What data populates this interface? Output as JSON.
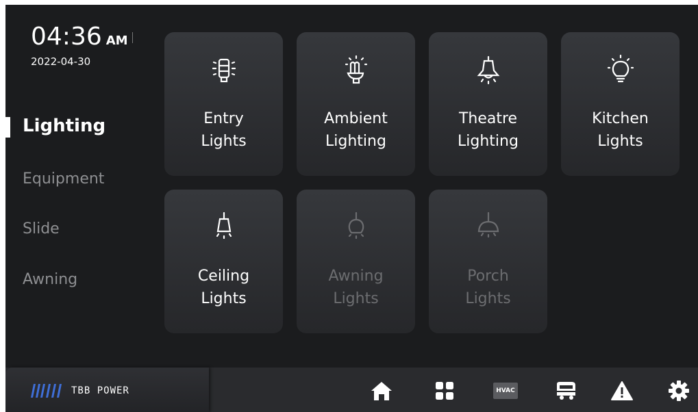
{
  "clock": {
    "time": "04:36",
    "ampm": "AM",
    "date": "2022-04-30"
  },
  "sidebar": {
    "items": [
      {
        "label": "Lighting",
        "active": true
      },
      {
        "label": "Equipment",
        "active": false
      },
      {
        "label": "Slide",
        "active": false
      },
      {
        "label": "Awning",
        "active": false
      }
    ]
  },
  "tiles": [
    {
      "line1": "Entry",
      "line2": "Lights",
      "icon": "entry-light-icon",
      "enabled": true
    },
    {
      "line1": "Ambient",
      "line2": "Lighting",
      "icon": "ambient-bulb-icon",
      "enabled": true
    },
    {
      "line1": "Theatre",
      "line2": "Lighting",
      "icon": "theatre-bell-light-icon",
      "enabled": true
    },
    {
      "line1": "Kitchen",
      "line2": "Lights",
      "icon": "kitchen-bulb-icon",
      "enabled": true
    },
    {
      "line1": "Ceiling",
      "line2": "Lights",
      "icon": "ceiling-lamp-icon",
      "enabled": true
    },
    {
      "line1": "Awning",
      "line2": "Lights",
      "icon": "awning-globe-light-icon",
      "enabled": false
    },
    {
      "line1": "Porch",
      "line2": "Lights",
      "icon": "porch-dome-light-icon",
      "enabled": false
    }
  ],
  "bottombar": {
    "brand": "TBB POWER",
    "nav": [
      {
        "name": "home",
        "icon": "home-icon"
      },
      {
        "name": "apps",
        "icon": "grid-icon"
      },
      {
        "name": "hvac",
        "label": "HVAC"
      },
      {
        "name": "rv",
        "icon": "rv-camper-icon"
      },
      {
        "name": "alerts",
        "icon": "warning-icon"
      },
      {
        "name": "settings",
        "icon": "gear-icon"
      }
    ]
  },
  "colors": {
    "background": "#1b1c1e",
    "tile": "#303236",
    "active_text": "#ffffff",
    "inactive_text": "#8e8f92",
    "disabled_text": "#6c6d70"
  }
}
